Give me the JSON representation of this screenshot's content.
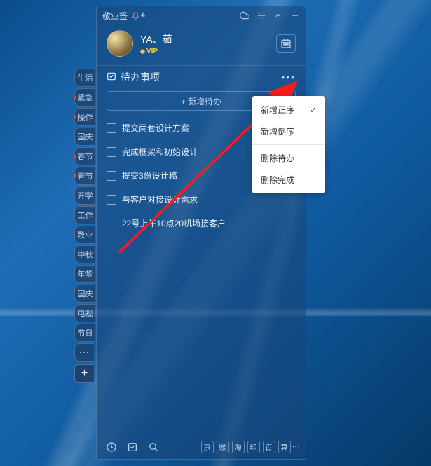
{
  "titlebar": {
    "app_name": "敬业签",
    "notification_count": "4"
  },
  "profile": {
    "username": "YA、茹",
    "vip_label": "VIP"
  },
  "section": {
    "title": "待办事项",
    "add_label": "+ 新增待办"
  },
  "todos": [
    {
      "text": "提交两套设计方案"
    },
    {
      "text": "完成框架和初始设计"
    },
    {
      "text": "提交3份设计稿"
    },
    {
      "text": "与客户对接设计需求"
    },
    {
      "text": "22号上午10点20机场接客户"
    }
  ],
  "side_tabs": [
    {
      "label": "生活",
      "red": false
    },
    {
      "label": "紧急",
      "red": true
    },
    {
      "label": "操作",
      "red": true
    },
    {
      "label": "国庆",
      "red": false
    },
    {
      "label": "春节",
      "red": true
    },
    {
      "label": "春节",
      "red": true
    },
    {
      "label": "开学",
      "red": false
    },
    {
      "label": "工作",
      "red": false
    },
    {
      "label": "敬业",
      "red": false
    },
    {
      "label": "中秋",
      "red": false
    },
    {
      "label": "年货",
      "red": false
    },
    {
      "label": "国庆",
      "red": false
    },
    {
      "label": "电视",
      "red": false
    },
    {
      "label": "节日",
      "red": false
    }
  ],
  "dropdown": {
    "sort_asc": "新增正序",
    "sort_desc": "新增倒序",
    "delete_todo": "删除待办",
    "delete_done": "删除完成"
  },
  "bottombar": {
    "squares": [
      "京",
      "账",
      "淘",
      "印",
      "百",
      "算"
    ]
  }
}
